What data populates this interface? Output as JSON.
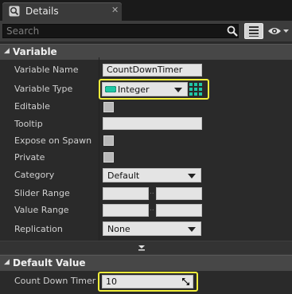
{
  "panel": {
    "title": "Details"
  },
  "search": {
    "placeholder": "Search"
  },
  "sections": {
    "variable": "Variable",
    "default_value": "Default Value"
  },
  "properties": {
    "variable_name": {
      "label": "Variable Name",
      "value": "CountDownTimer"
    },
    "variable_type": {
      "label": "Variable Type",
      "value": "Integer",
      "type_color": "#1fc7a4"
    },
    "editable": {
      "label": "Editable",
      "checked": false
    },
    "tooltip": {
      "label": "Tooltip",
      "value": ""
    },
    "expose_on_spawn": {
      "label": "Expose on Spawn",
      "checked": false
    },
    "private": {
      "label": "Private",
      "checked": false
    },
    "category": {
      "label": "Category",
      "value": "Default"
    },
    "slider_range": {
      "label": "Slider Range",
      "min": "",
      "max": ""
    },
    "value_range": {
      "label": "Value Range",
      "min": "",
      "max": ""
    },
    "replication": {
      "label": "Replication",
      "value": "None"
    }
  },
  "default_values": {
    "count_down_timer": {
      "label": "Count Down Timer",
      "value": "10"
    }
  },
  "colors": {
    "highlight": "#f2ef3a",
    "integer_pin": "#1fc7a4"
  }
}
